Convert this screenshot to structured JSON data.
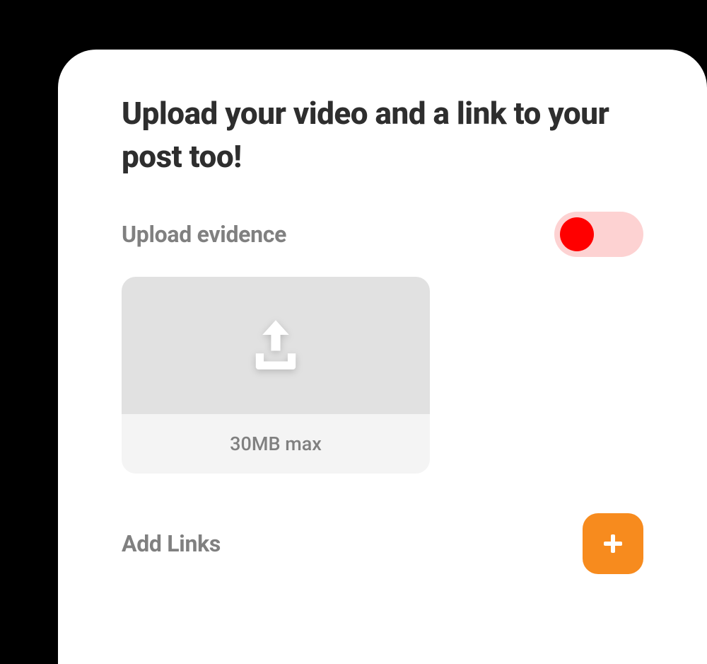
{
  "heading": "Upload your video and a link to your post too!",
  "evidence": {
    "label": "Upload evidence",
    "toggle_on": false,
    "upload_hint": "30MB max"
  },
  "links": {
    "label": "Add Links"
  },
  "colors": {
    "accent_orange": "#f78b1e",
    "toggle_off_bg": "#fdd2d2",
    "toggle_off_knob": "#ff0000"
  }
}
